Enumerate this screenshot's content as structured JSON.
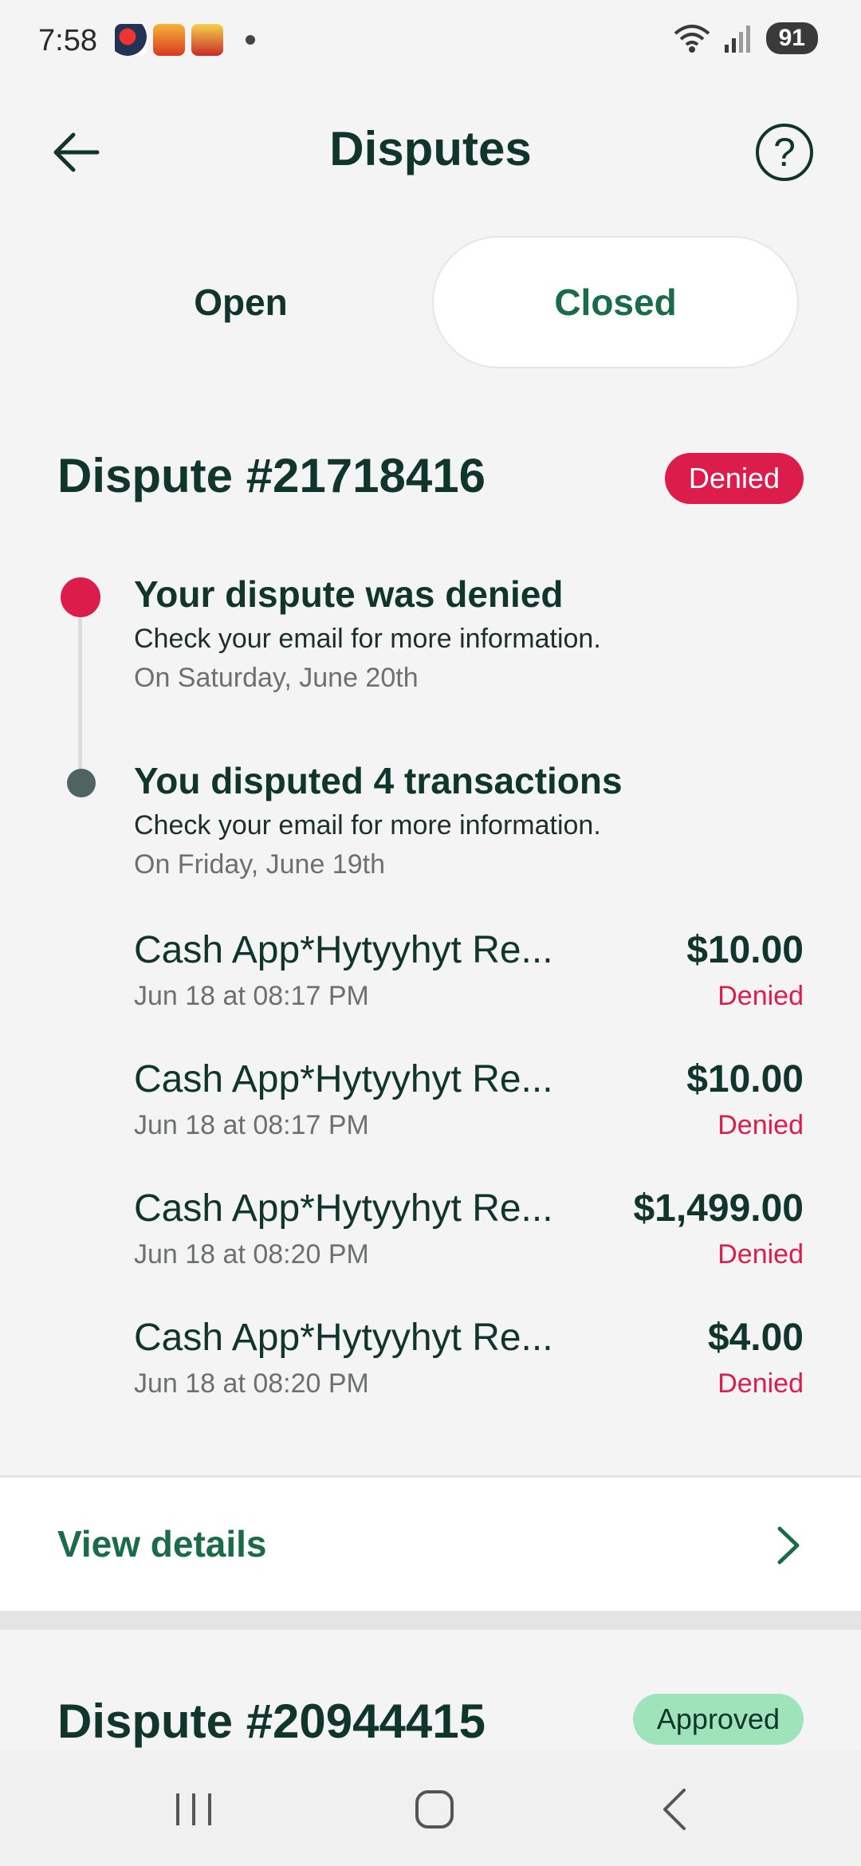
{
  "status_bar": {
    "time": "7:58",
    "battery": "91",
    "wifi_label": "6"
  },
  "header": {
    "title": "Disputes",
    "help": "?"
  },
  "tabs": {
    "open_label": "Open",
    "closed_label": "Closed",
    "active": "Closed"
  },
  "dispute": {
    "title": "Dispute #21718416",
    "status": "Denied",
    "events": [
      {
        "title": "Your dispute was denied",
        "subtitle": "Check your email for more information.",
        "date": "On Saturday, June 20th"
      },
      {
        "title": "You disputed 4 transactions",
        "subtitle": "Check your email for more information.",
        "date": "On Friday, June 19th"
      }
    ],
    "transactions": [
      {
        "name": "Cash App*Hytyyhyt Re...",
        "time": "Jun 18 at 08:17 PM",
        "amount": "$10.00",
        "status": "Denied"
      },
      {
        "name": "Cash App*Hytyyhyt Re...",
        "time": "Jun 18 at 08:17 PM",
        "amount": "$10.00",
        "status": "Denied"
      },
      {
        "name": "Cash App*Hytyyhyt Re...",
        "time": "Jun 18 at 08:20 PM",
        "amount": "$1,499.00",
        "status": "Denied"
      },
      {
        "name": "Cash App*Hytyyhyt Re...",
        "time": "Jun 18 at 08:20 PM",
        "amount": "$4.00",
        "status": "Denied"
      }
    ],
    "view_details_label": "View details"
  },
  "dispute2": {
    "title": "Dispute #20944415",
    "status": "Approved"
  },
  "colors": {
    "accent_green": "#1a6b47",
    "denied_red": "#dc1d4c",
    "approved_green": "#9ee3b9",
    "text_dark": "#10352a"
  }
}
